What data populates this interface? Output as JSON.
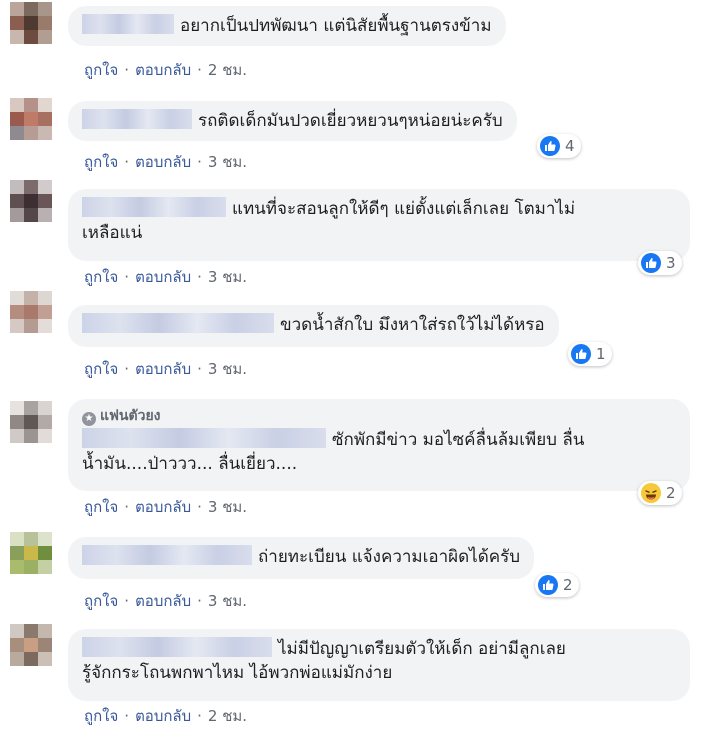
{
  "action_like": "ถูกใจ",
  "action_reply": "ตอบกลับ",
  "separator": "·",
  "comments": [
    {
      "text": "อยากเป็นปทพัฒนา แต่นิสัยพื้นฐานตรงข้าม",
      "time": "2 ชม."
    },
    {
      "text": "รถติดเด็กมันปวดเยี่ยวหยวนๆหน่อยน่ะครับ",
      "time": "3 ชม.",
      "reaction": {
        "icon": "like-icon",
        "count": "4"
      }
    },
    {
      "text_line1": "แทนที่จะสอนลูกให้ดีๆ แย่ตั้งแต่เล็กเลย โตมาไม่",
      "text_line2": "เหลือแน่",
      "time": "3 ชม.",
      "reaction": {
        "icon": "like-icon",
        "count": "3"
      }
    },
    {
      "text": "ขวดน้ำสักใบ มึงหาใส่รถใว้ไม่ได้หรอ",
      "time": "3 ชม.",
      "reaction": {
        "icon": "like-icon",
        "count": "1"
      }
    },
    {
      "badge": "แฟนตัวยง",
      "text_line1": "ซักพักมีข่าว มอไซค์ลื่นล้มเพียบ ลื่น",
      "text_line2": "น้ำมัน....ป่าววว... ลื่นเยี่ยว....",
      "time": "3 ชม.",
      "reaction": {
        "icon": "haha-icon",
        "count": "2"
      }
    },
    {
      "text": "ถ่ายทะเบียน แจ้งความเอาผิดได้ครับ",
      "time": "3 ชม.",
      "reaction": {
        "icon": "like-icon",
        "count": "2"
      }
    },
    {
      "text_line1": "ไม่มีปัญญาเตรียมตัวให้เด็ก อย่ามีลูกเลย",
      "text_line2": "รู้จักกระโถนพกพาไหม ไอ้พวกพ่อแม่มักง่าย",
      "time": "2 ชม."
    }
  ],
  "colors": {
    "link": "#385898",
    "bubble": "#f2f3f5",
    "like": "#1877f2",
    "meta": "#606770"
  }
}
